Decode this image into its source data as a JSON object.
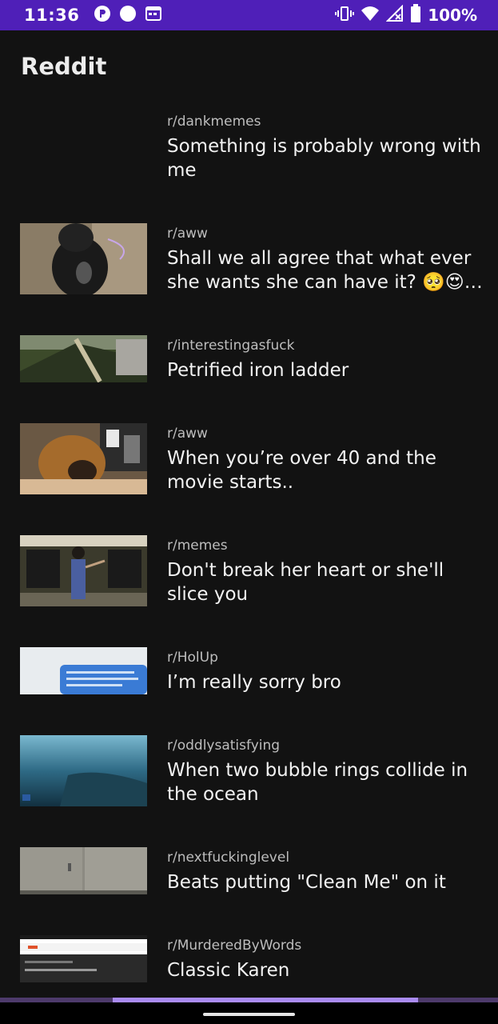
{
  "status_bar": {
    "time": "11:36",
    "battery": "100%",
    "background": "#4f1fb8"
  },
  "app": {
    "title": "Reddit"
  },
  "posts": [
    {
      "subreddit": "r/dankmemes",
      "title": "Something is probably wrong with me"
    },
    {
      "subreddit": "r/aww",
      "title": "Shall we all agree that what ever she wants she can have it? 🥺😍…"
    },
    {
      "subreddit": "r/interestingasfuck",
      "title": "Petrified iron ladder"
    },
    {
      "subreddit": "r/aww",
      "title": "When you’re over 40 and the movie starts.."
    },
    {
      "subreddit": "r/memes",
      "title": "Don't break her heart or she'll slice you"
    },
    {
      "subreddit": "r/HolUp",
      "title": "I’m really sorry bro"
    },
    {
      "subreddit": "r/oddlysatisfying",
      "title": "When two bubble rings collide in the ocean"
    },
    {
      "subreddit": "r/nextfuckinglevel",
      "title": "Beats putting \"Clean Me\" on it"
    },
    {
      "subreddit": "r/MurderedByWords",
      "title": "Classic Karen"
    }
  ],
  "icons": {
    "status_left": [
      "notification-p-icon",
      "circle-icon",
      "calendar-icon"
    ],
    "status_right": [
      "vibrate-icon",
      "wifi-icon",
      "signal-icon",
      "battery-icon"
    ]
  },
  "colors": {
    "accent": "#a98af2",
    "background": "#121212"
  }
}
